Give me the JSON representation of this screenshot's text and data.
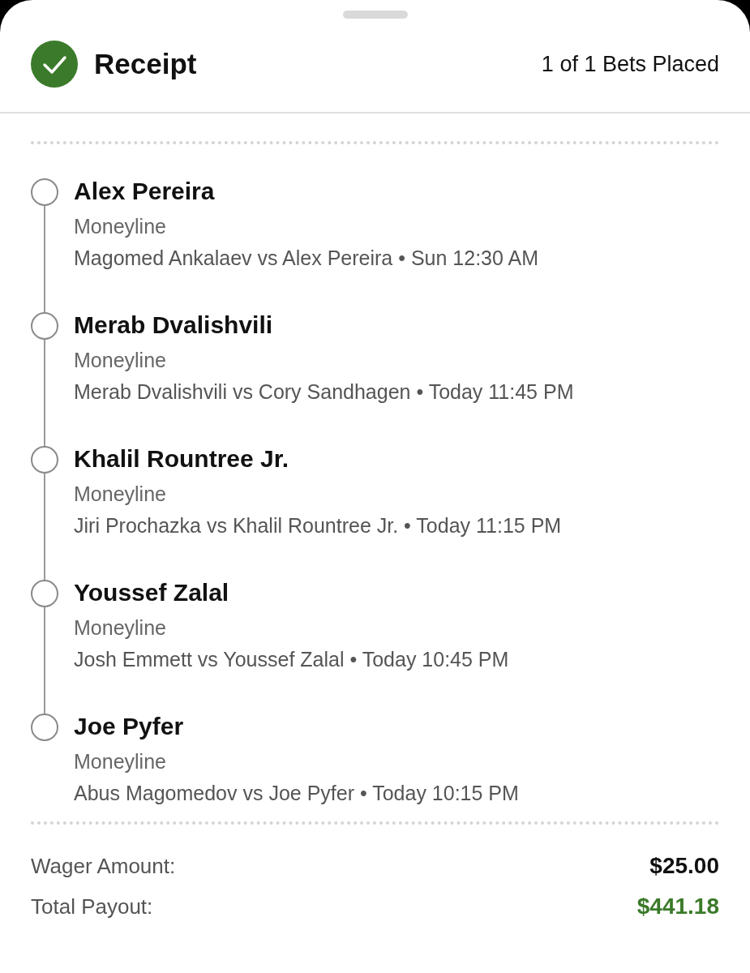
{
  "header": {
    "title": "Receipt",
    "status": "1 of 1 Bets Placed"
  },
  "legs": [
    {
      "selection": "Alex Pereira",
      "market": "Moneyline",
      "event": "Magomed Ankalaev vs Alex Pereira • Sun 12:30 AM"
    },
    {
      "selection": "Merab Dvalishvili",
      "market": "Moneyline",
      "event": "Merab Dvalishvili vs Cory Sandhagen • Today 11:45 PM"
    },
    {
      "selection": "Khalil Rountree Jr.",
      "market": "Moneyline",
      "event": "Jiri Prochazka vs Khalil Rountree Jr. • Today 11:15 PM"
    },
    {
      "selection": "Youssef Zalal",
      "market": "Moneyline",
      "event": "Josh Emmett vs Youssef Zalal • Today 10:45 PM"
    },
    {
      "selection": "Joe Pyfer",
      "market": "Moneyline",
      "event": "Abus Magomedov vs Joe Pyfer • Today 10:15 PM"
    }
  ],
  "summary": [
    {
      "label": "Wager Amount:",
      "value": "$25.00",
      "kind": "plain"
    },
    {
      "label": "Total Payout:",
      "value": "$441.18",
      "kind": "payout"
    }
  ]
}
